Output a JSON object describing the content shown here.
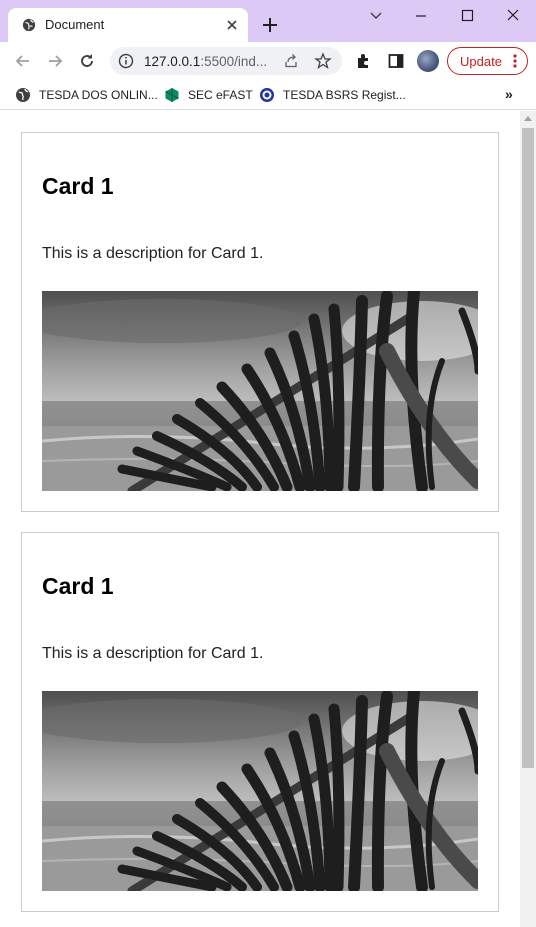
{
  "browser": {
    "tab": {
      "title": "Document"
    },
    "address_bar": {
      "host": "127.0.0.1",
      "rest": ":5500/ind..."
    },
    "update_button": {
      "label": "Update"
    },
    "bookmarks": [
      {
        "label": "TESDA DOS ONLIN..."
      },
      {
        "label": "SEC eFAST"
      },
      {
        "label": "TESDA BSRS Regist..."
      }
    ],
    "bookmarks_overflow": "»"
  },
  "cards": [
    {
      "title": "Card 1",
      "description": "This is a description for Card 1."
    },
    {
      "title": "Card 1",
      "description": "This is a description for Card 1."
    }
  ],
  "colors": {
    "tabstrip": "#dcc9f5",
    "update_accent": "#c5221f",
    "card_border": "#cccccc"
  }
}
